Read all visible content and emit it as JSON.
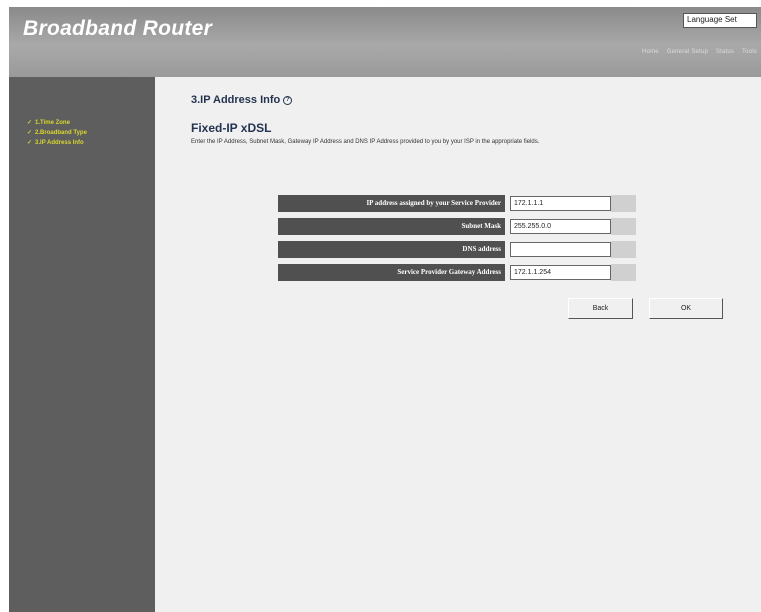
{
  "header": {
    "title": "Broadband Router",
    "language": "Language Set",
    "top_links": [
      "Home",
      "General Setup",
      "Status",
      "Tools"
    ]
  },
  "sidebar": {
    "items": [
      {
        "label": "1.Time Zone"
      },
      {
        "label": "2.Broadband Type"
      },
      {
        "label": "3.IP Address Info"
      }
    ]
  },
  "main": {
    "section_title": "3.IP Address Info",
    "subtitle": "Fixed-IP xDSL",
    "description": "Enter the IP Address, Subnet Mask, Gateway IP Address and DNS IP Address provided to you by your ISP in the appropriate fields.",
    "fields": [
      {
        "label": "IP address assigned by your Service Provider",
        "value": "172.1.1.1"
      },
      {
        "label": "Subnet Mask",
        "value": "255.255.0.0"
      },
      {
        "label": "DNS address",
        "value": ""
      },
      {
        "label": "Service Provider Gateway Address",
        "value": "172.1.1.254"
      }
    ],
    "back_label": "Back",
    "ok_label": "OK"
  }
}
